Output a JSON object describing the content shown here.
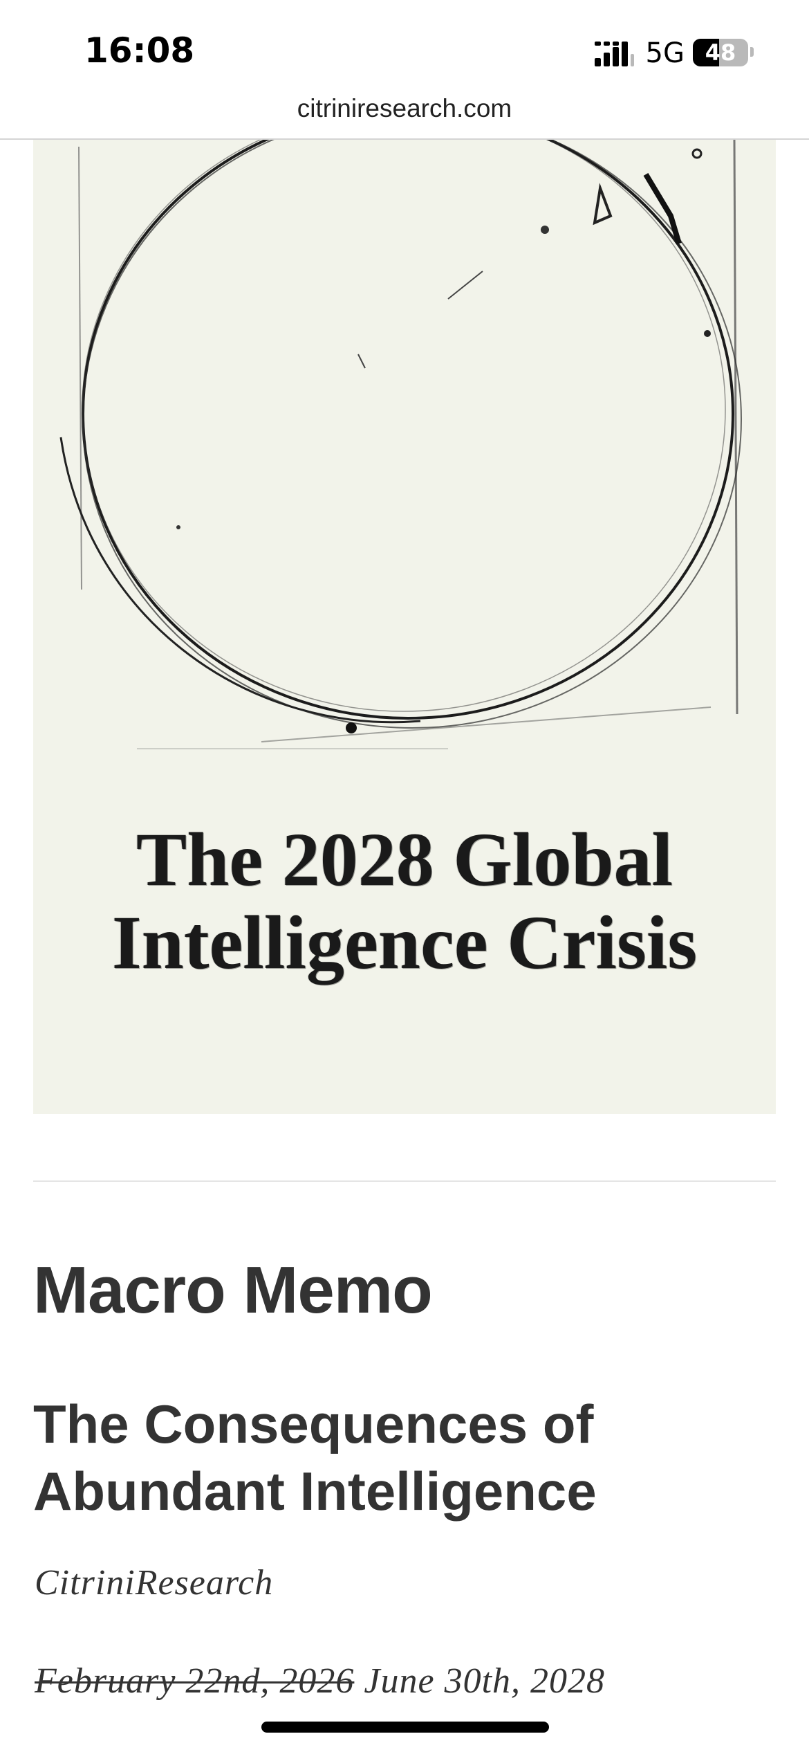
{
  "status_bar": {
    "time": "16:08",
    "network": "5G",
    "battery": "48",
    "battery_level": 0.48
  },
  "browser": {
    "url": "citriniresearch.com"
  },
  "hero": {
    "title_line1": "The 2028 Global",
    "title_line2": "Intelligence Crisis",
    "background": "#f2f3ea"
  },
  "article": {
    "section": "Macro Memo",
    "title": "The Consequences of Abundant Intelligence",
    "author": "CitriniResearch",
    "date_struck": "February 22nd, 2026",
    "date": "June 30th, 2028"
  },
  "colors": {
    "text": "#333333",
    "divider": "#e5e5e5"
  }
}
